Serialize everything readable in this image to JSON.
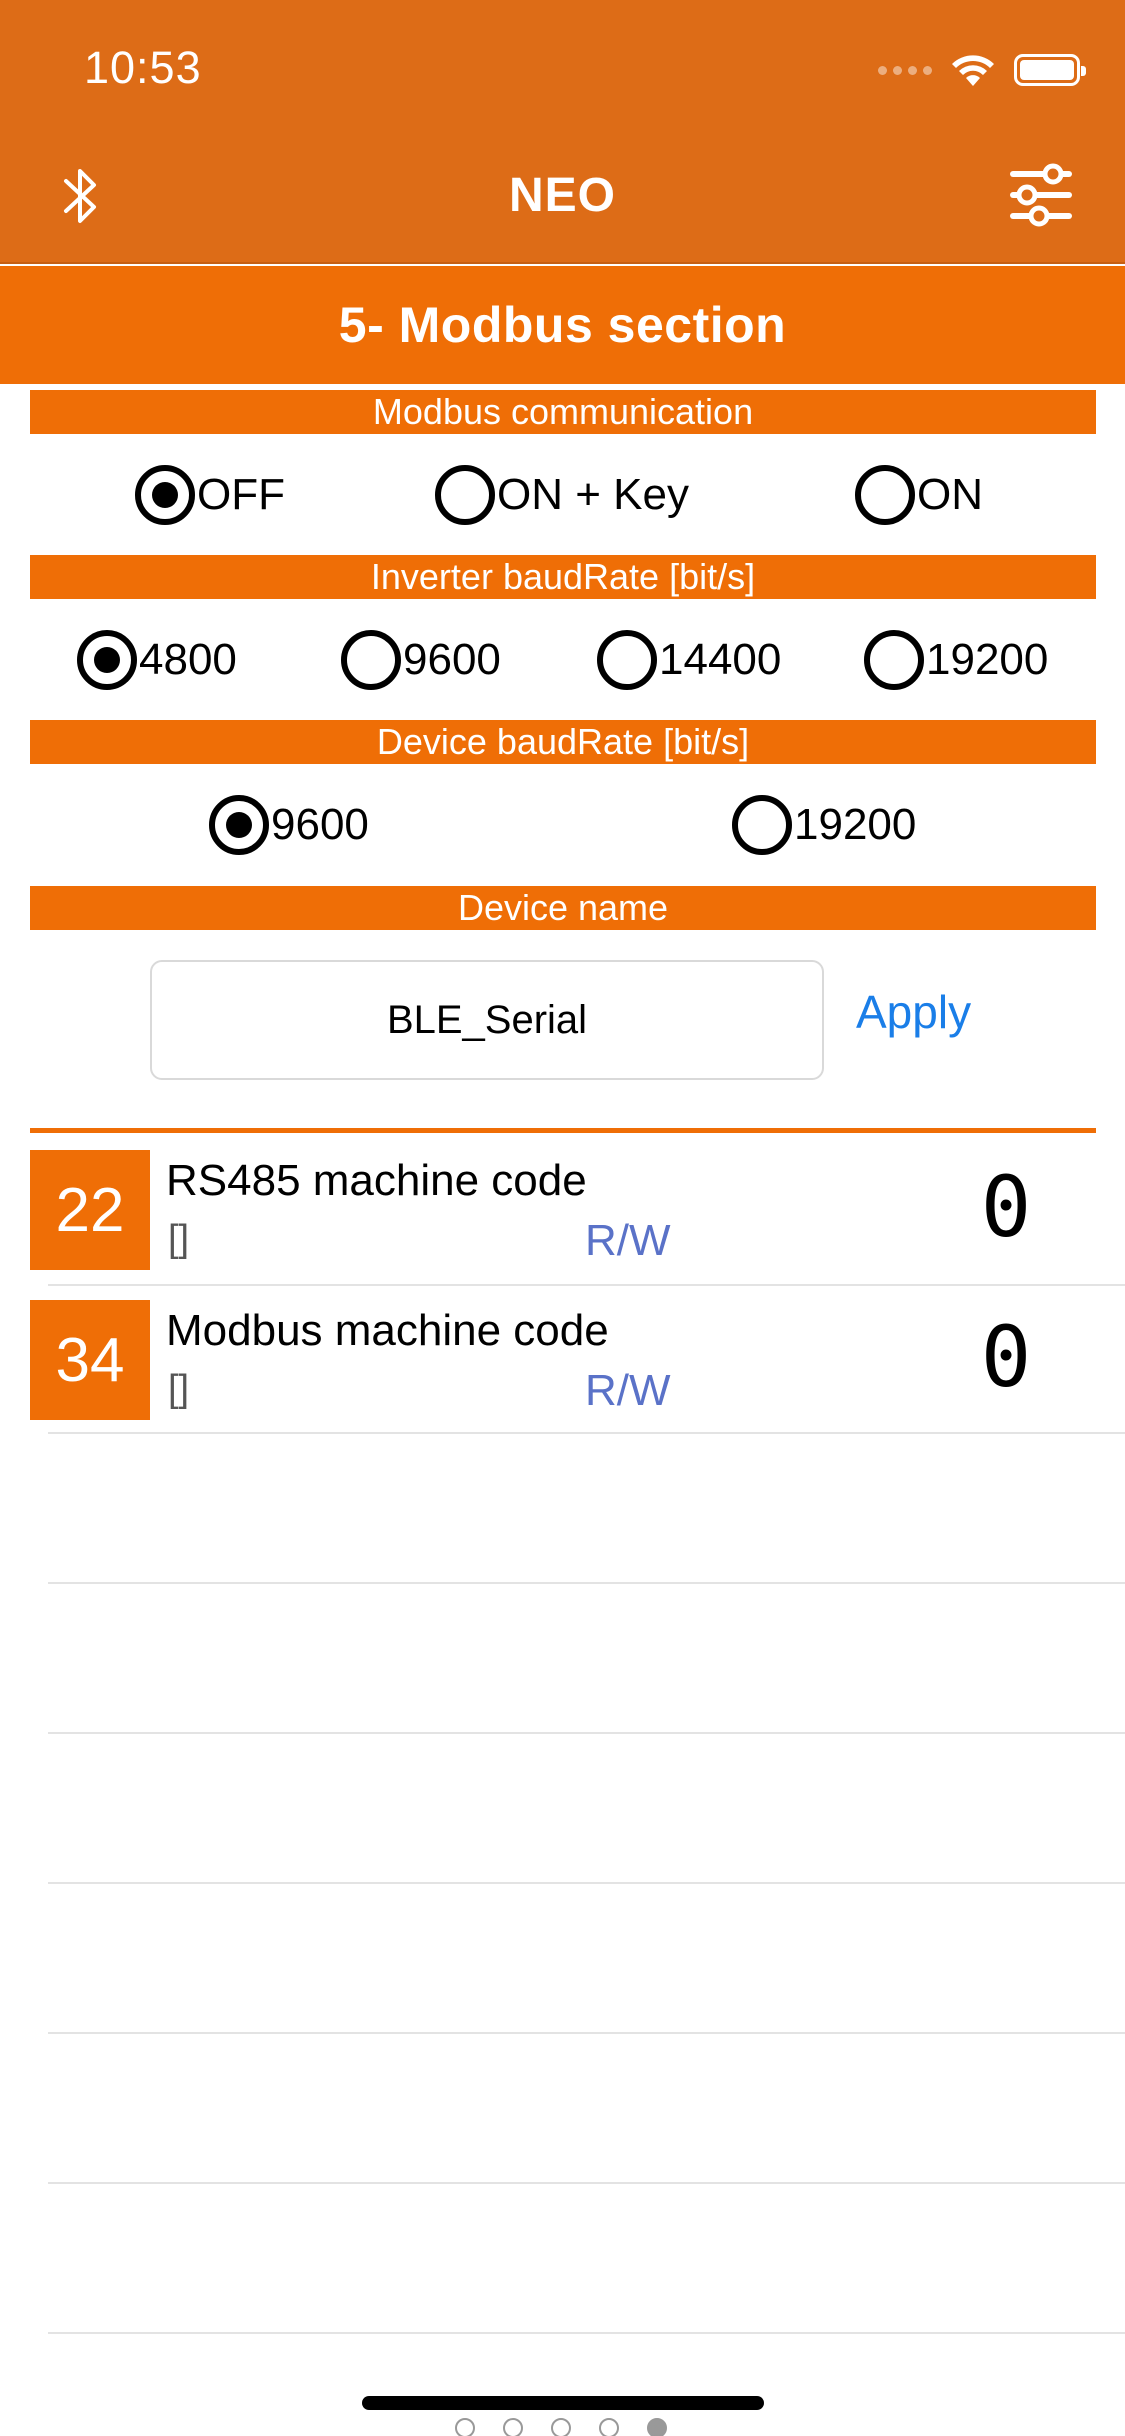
{
  "status": {
    "time": "10:53"
  },
  "nav": {
    "title": "NEO",
    "left_icon": "bluetooth-icon",
    "right_icon": "sliders-icon"
  },
  "section_title": "5- Modbus section",
  "modbus_communication": {
    "header": "Modbus communication",
    "options": [
      "OFF",
      "ON + Key",
      "ON"
    ],
    "selected": "OFF"
  },
  "inverter_baudrate": {
    "header": "Inverter baudRate [bit/s]",
    "options": [
      "4800",
      "9600",
      "14400",
      "19200"
    ],
    "selected": "4800"
  },
  "device_baudrate": {
    "header": "Device baudRate [bit/s]",
    "options": [
      "9600",
      "19200"
    ],
    "selected": "9600"
  },
  "device_name": {
    "header": "Device name",
    "value": "BLE_Serial",
    "apply_label": "Apply"
  },
  "registers": [
    {
      "code": "22",
      "title": "RS485 machine code",
      "sub": "[]",
      "access": "R/W",
      "value": "0"
    },
    {
      "code": "34",
      "title": "Modbus machine code",
      "sub": "[]",
      "access": "R/W",
      "value": "0"
    }
  ],
  "pager": {
    "count": 5,
    "active_index": 4
  },
  "colors": {
    "nav_bg": "#dd6c17",
    "accent": "#ef6e06",
    "link": "#1a7ee8",
    "rw_text": "#5a72c8"
  }
}
